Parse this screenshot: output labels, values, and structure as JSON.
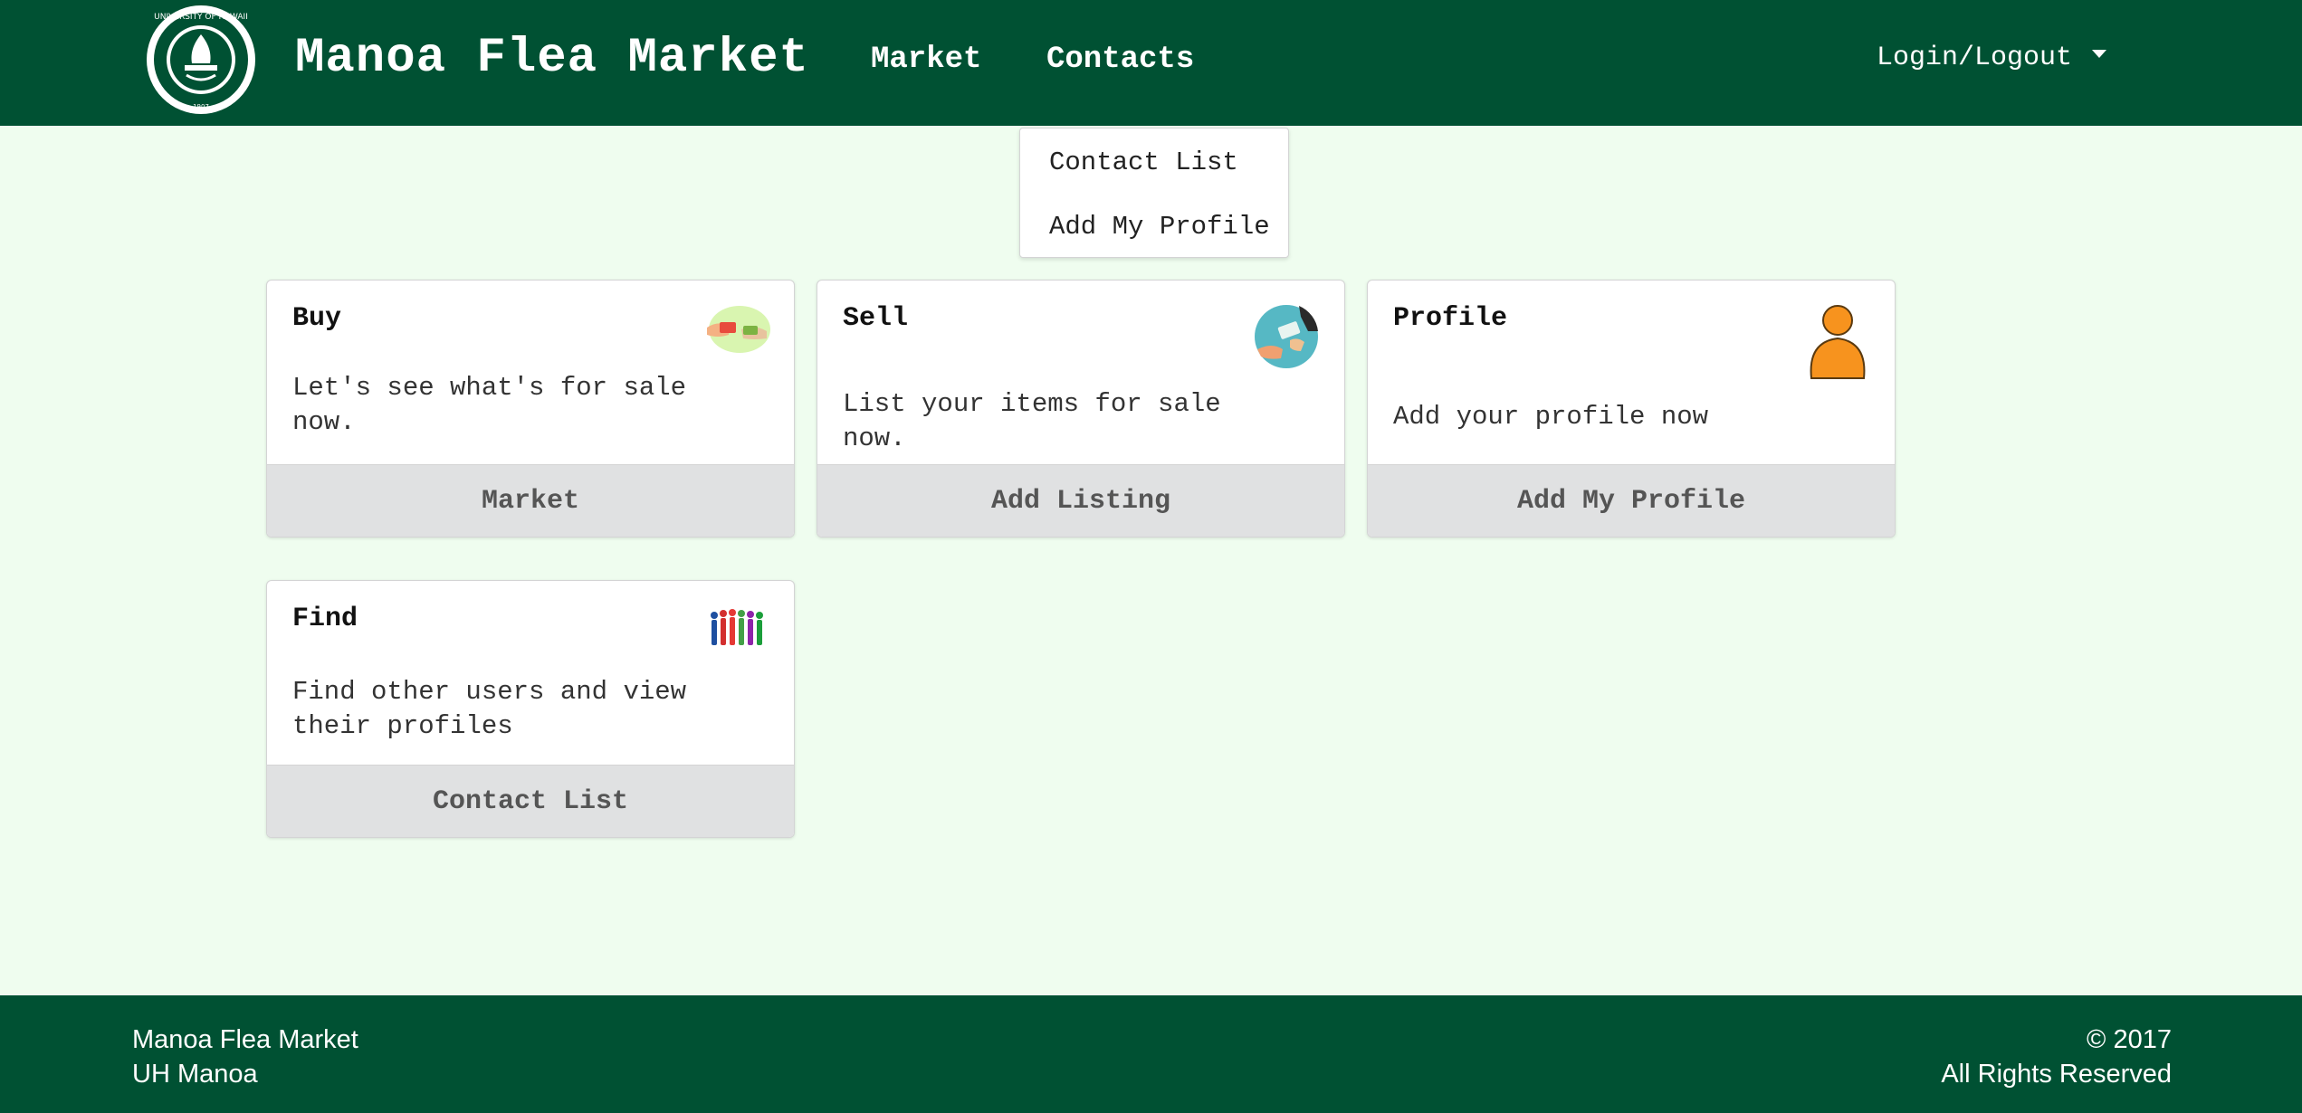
{
  "header": {
    "brand": "Manoa Flea Market",
    "nav": {
      "market": "Market",
      "contacts": "Contacts"
    },
    "login": "Login/Logout",
    "logo_text": "UNIVERSITY OF HAWAII · MANOA · 1907",
    "bg_color": "#005133"
  },
  "dropdown": {
    "items": [
      "Contact List",
      "Add My Profile"
    ]
  },
  "cards": [
    {
      "header": "Buy",
      "description": "Let's see what's for sale now.",
      "button": "Market",
      "icon": "hands-exchange-icon"
    },
    {
      "header": "Sell",
      "description": "List your items for sale now.",
      "button": "Add Listing",
      "icon": "money-exchange-icon"
    },
    {
      "header": "Profile",
      "description": "Add your profile now",
      "button": "Add My Profile",
      "icon": "person-icon"
    },
    {
      "header": "Find",
      "description": "Find other users and view their profiles",
      "button": "Contact List",
      "icon": "people-group-icon"
    }
  ],
  "footer": {
    "left": [
      "Manoa Flea Market",
      "UH Manoa"
    ],
    "right": [
      "©  2017",
      "All Rights Reserved"
    ]
  },
  "colors": {
    "page_bg": "#effdef",
    "button_bg": "#e0e1e2"
  }
}
